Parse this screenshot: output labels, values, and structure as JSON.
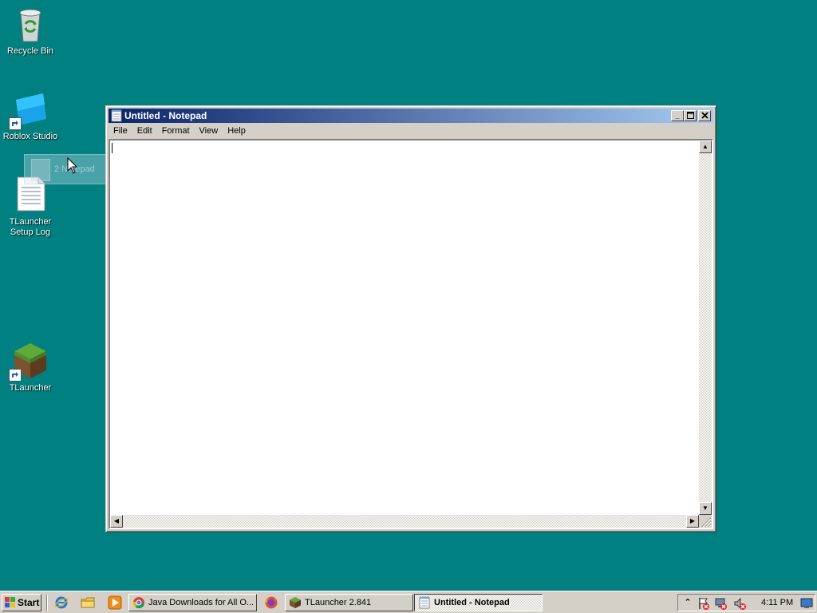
{
  "desktop": {
    "icons": [
      {
        "label": "Recycle Bin",
        "icon": "recycle-bin-icon"
      },
      {
        "label": "Roblox Studio",
        "icon": "roblox-studio-icon"
      },
      {
        "label": "TLauncher\nSetup Log",
        "icon": "text-file-icon"
      },
      {
        "label": "TLauncher",
        "icon": "minecraft-grass-block-icon"
      }
    ],
    "drag_ghost_label": "2 Notepad"
  },
  "window": {
    "title": "Untitled - Notepad",
    "menu": [
      "File",
      "Edit",
      "Format",
      "View",
      "Help"
    ],
    "content": ""
  },
  "taskbar": {
    "start_label": "Start",
    "tasks": [
      {
        "label": "Java Downloads for All O...",
        "icon": "chrome-icon"
      },
      {
        "label": "TLauncher 2.841",
        "icon": "minecraft-grass-block-icon"
      },
      {
        "label": "Untitled - Notepad",
        "icon": "notepad-icon",
        "active": true
      }
    ],
    "clock": "4:11 PM"
  },
  "colors": {
    "desktop": "#008080",
    "titlebar_start": "#0a246a",
    "titlebar_end": "#a6caf0",
    "face": "#d4d0c8"
  }
}
